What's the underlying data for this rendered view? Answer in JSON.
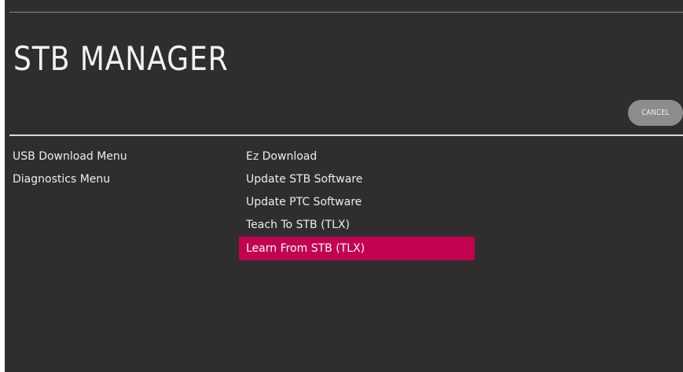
{
  "header": {
    "title": "STB MANAGER",
    "cancel_label": "CANCEL"
  },
  "left_menu": {
    "items": [
      {
        "label": "USB Download Menu"
      },
      {
        "label": "Diagnostics Menu"
      }
    ]
  },
  "right_menu": {
    "selected_index": 4,
    "items": [
      {
        "label": "Ez Download"
      },
      {
        "label": "Update STB Software"
      },
      {
        "label": "Update PTC Software"
      },
      {
        "label": "Teach To STB (TLX)"
      },
      {
        "label": "Learn From STB (TLX)"
      }
    ]
  },
  "colors": {
    "background": "#2f2d2d",
    "highlight": "#c3024f",
    "button": "#8d8b8b",
    "text": "#ededed"
  }
}
